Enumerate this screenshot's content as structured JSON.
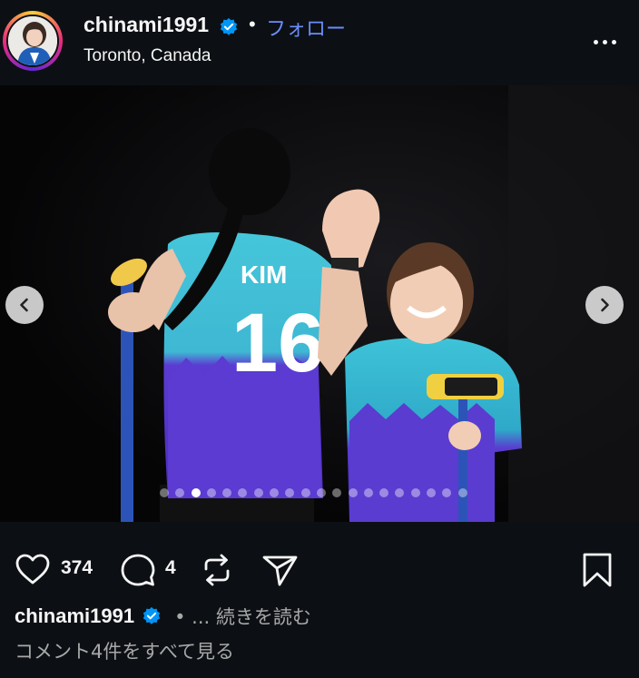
{
  "post": {
    "username": "chinami1991",
    "verified": true,
    "separator": "•",
    "follow_label": "フォロー",
    "location": "Toronto, Canada"
  },
  "media": {
    "jersey_name": "KIM",
    "jersey_number": "16",
    "carousel_total": 20,
    "carousel_active_index": 2
  },
  "actions": {
    "like_count": "374",
    "comment_count": "4"
  },
  "caption": {
    "username": "chinami1991",
    "more_label": "• ... 続きを読む"
  },
  "comments_link": "コメント4件をすべて見る",
  "colors": {
    "background": "#0c1014",
    "follow_blue": "#6c8dfa",
    "verified_blue": "#0095f6",
    "jersey_teal": "#3fc1d6",
    "jersey_purple": "#5b3bd1"
  }
}
